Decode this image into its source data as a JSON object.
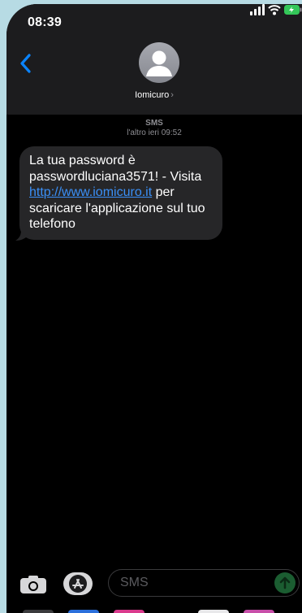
{
  "status_bar": {
    "time": "08:39"
  },
  "header": {
    "contact_name": "Iomicuro",
    "chevron": "›"
  },
  "conversation": {
    "service_label": "SMS",
    "timestamp": "l'altro ieri 09:52",
    "message": {
      "text_before": "La tua password è passwordluciana3571! - Visita ",
      "link": "http://www.iomicuro.it",
      "text_after": " per scaricare l'applicazione sul tuo telefono"
    }
  },
  "composer": {
    "placeholder": "SMS"
  },
  "icons": [
    "back-chevron-icon",
    "signal-icon",
    "wifi-icon",
    "battery-charging-icon",
    "person-icon",
    "camera-icon",
    "app-store-icon",
    "send-arrow-icon"
  ],
  "colors": {
    "link": "#3a8ff6",
    "bubble": "#262628",
    "header": "#1c1c1e",
    "accent_blue": "#0a84ff",
    "send_green": "#1b5d31"
  }
}
